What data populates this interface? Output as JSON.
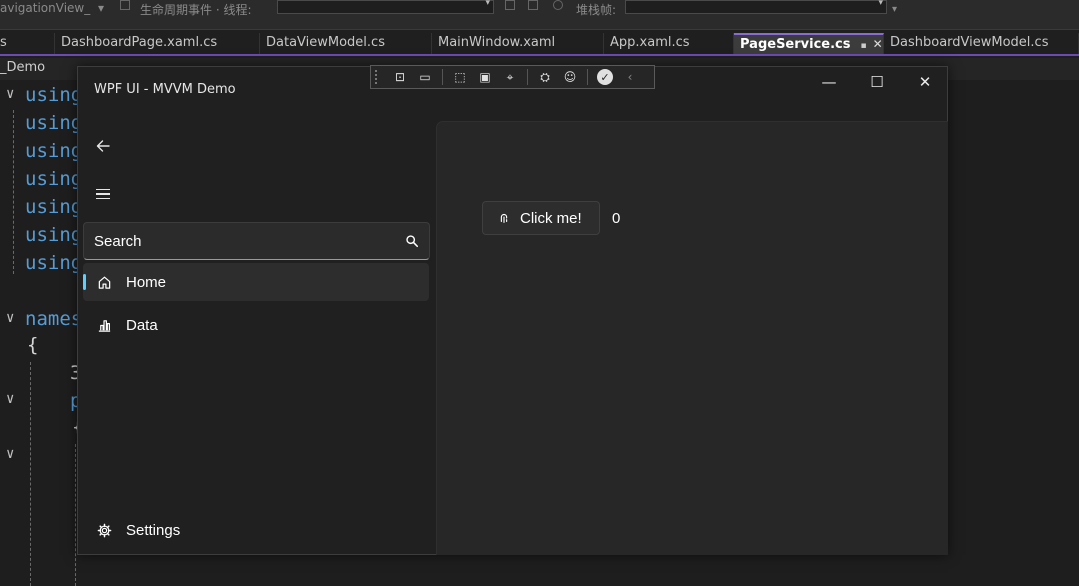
{
  "vs": {
    "toolbar": {
      "frame_label": "avigationView_",
      "thread_label": "生命周期事件 · 线程:",
      "stack_label": "堆栈帧:"
    },
    "tabs": [
      {
        "label": "s"
      },
      {
        "label": "DashboardPage.xaml.cs"
      },
      {
        "label": "DataViewModel.cs"
      },
      {
        "label": "MainWindow.xaml"
      },
      {
        "label": "App.xaml.cs"
      },
      {
        "label": "PageService.cs",
        "active": true
      },
      {
        "label": "DashboardViewModel.cs"
      }
    ],
    "project_label": "_Demo",
    "code_lines": [
      "using",
      "using",
      "using",
      "using",
      "using",
      "using",
      "using"
    ],
    "namespace_keyword": "names",
    "brace_open": "{",
    "frag_1": "3",
    "frag_2": "p",
    "frag_3": "{"
  },
  "app": {
    "title": "WPF UI - MVVM Demo",
    "window_controls": {
      "minimize": "—",
      "maximize": "☐",
      "close": "✕"
    },
    "search": {
      "placeholder": "Search"
    },
    "nav_items": [
      {
        "label": "Home",
        "icon": "home-icon",
        "selected": true
      },
      {
        "label": "Data",
        "icon": "data-bar-chart-icon",
        "selected": false
      }
    ],
    "footer_item": {
      "label": "Settings",
      "icon": "gear-icon"
    },
    "content": {
      "button_label": "Click me!",
      "counter": "0"
    },
    "accent_color": "#60cdff"
  }
}
